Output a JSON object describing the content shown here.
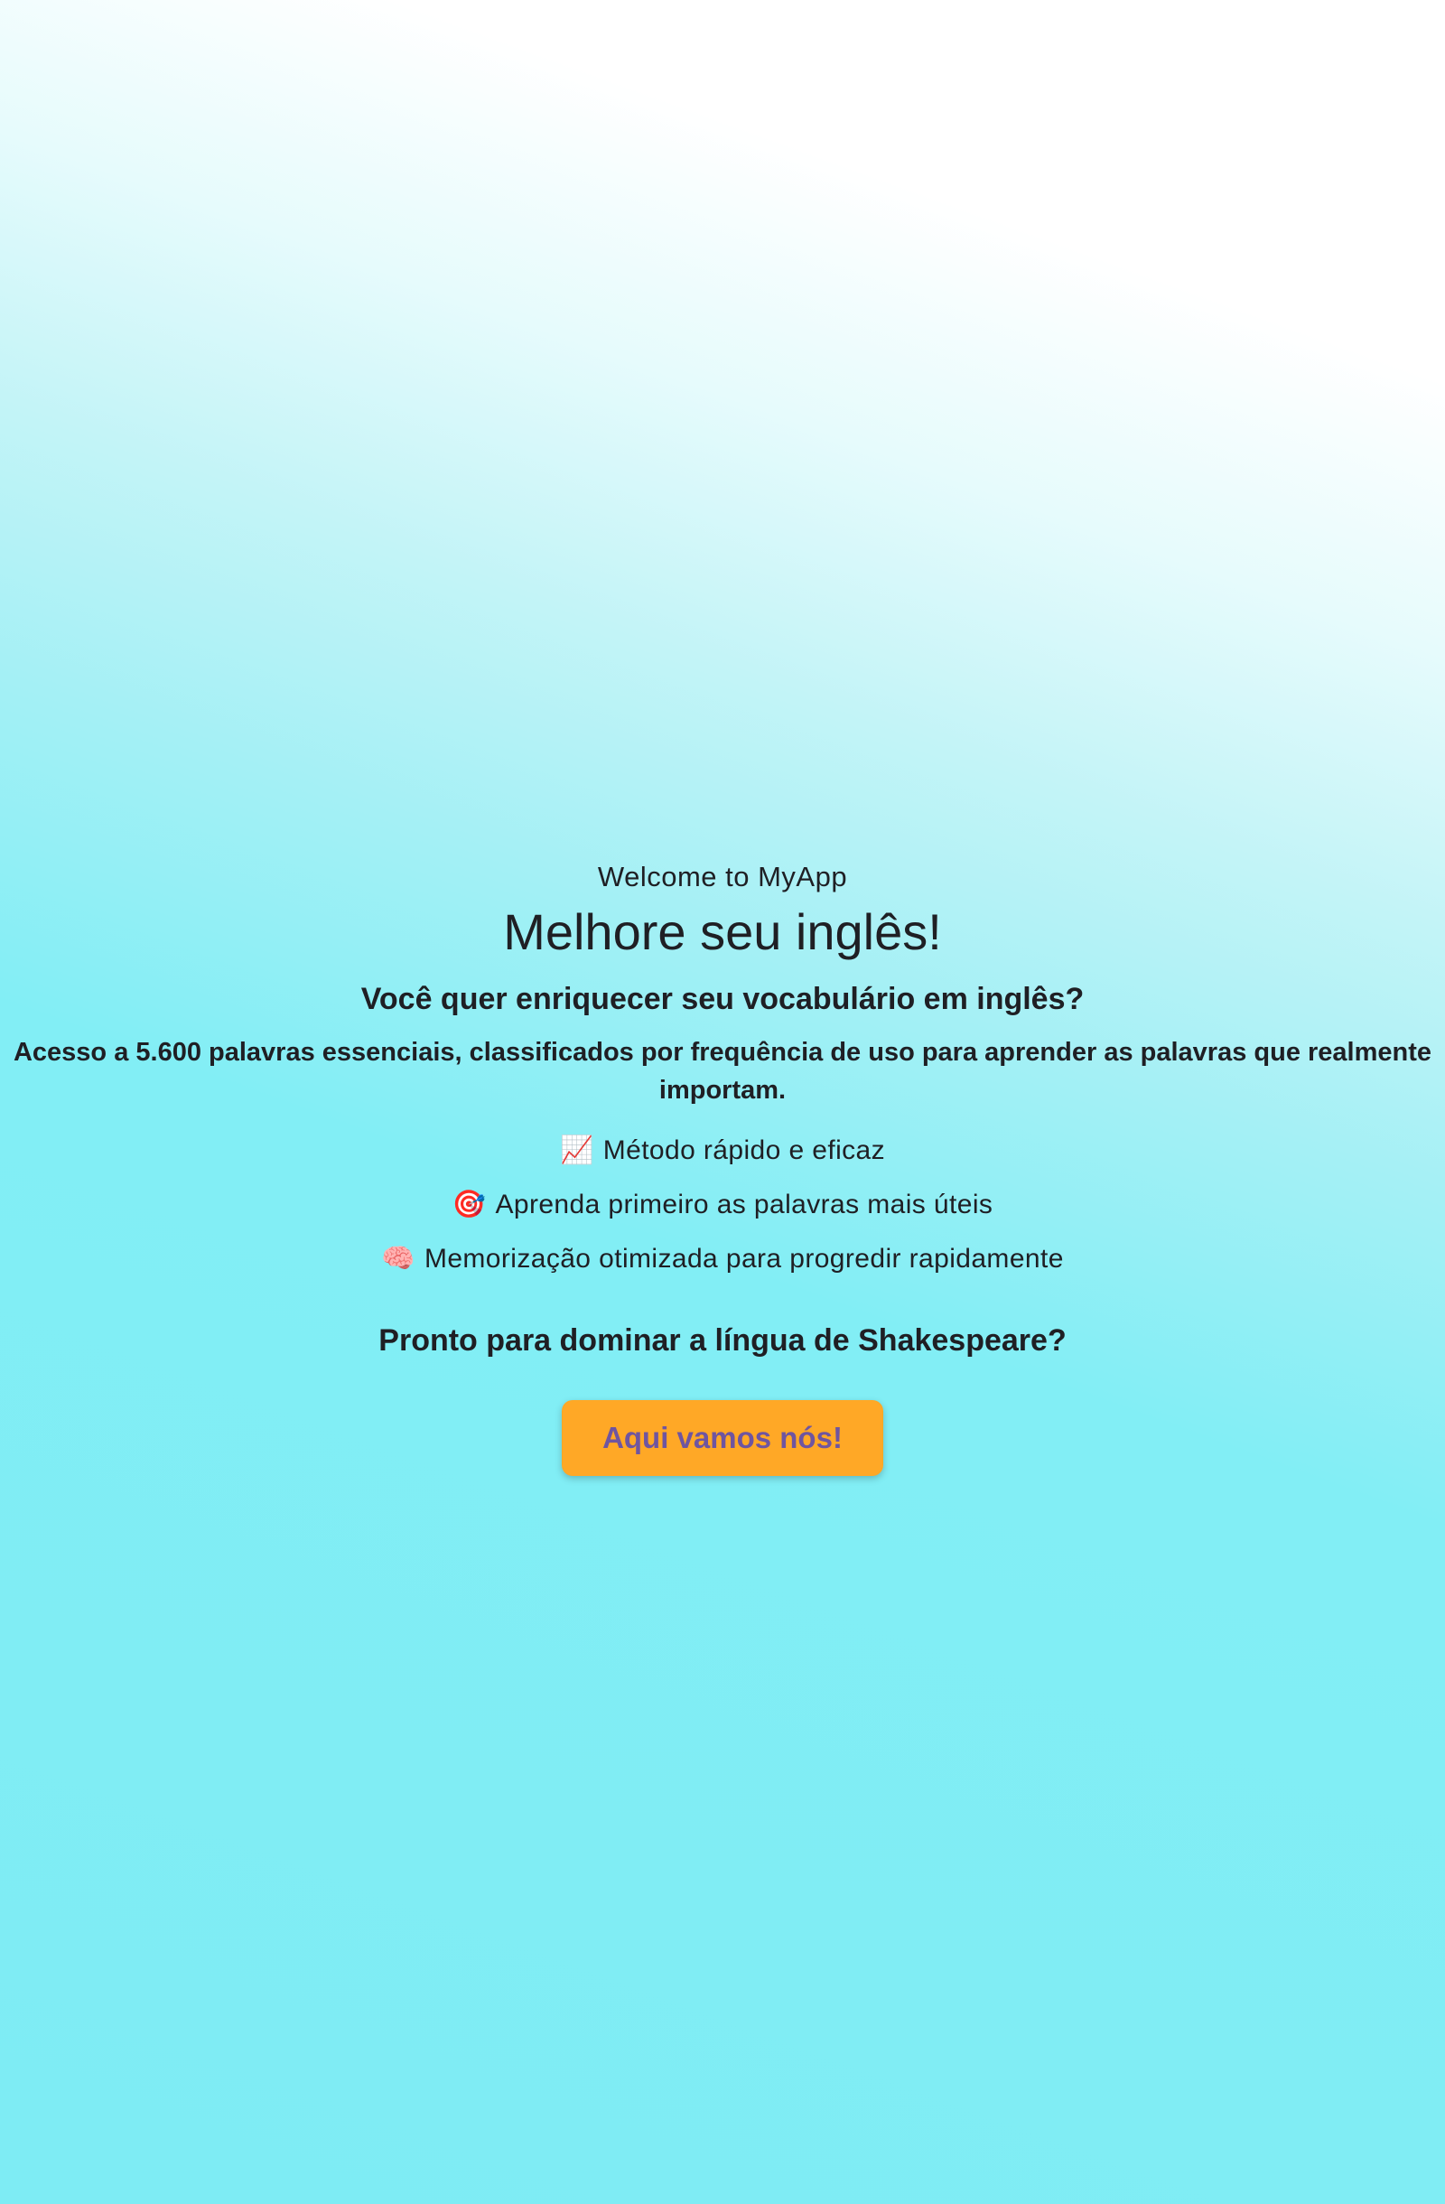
{
  "hero": {
    "welcome": "Welcome to MyApp",
    "headline": "Melhore seu inglês!",
    "question": "Você quer enriquecer seu vocabulário em inglês?",
    "intro_prefix": "Acesso a ",
    "intro_highlight": "5.600 palavras essenciais",
    "intro_suffix": ", classificados por frequência de uso para aprender as palavras que realmente importam."
  },
  "features": [
    {
      "icon": "chart-increasing-icon",
      "emoji": "📈",
      "text": "Método rápido e eficaz"
    },
    {
      "icon": "target-icon",
      "emoji": "🎯",
      "text": "Aprenda primeiro as palavras mais úteis"
    },
    {
      "icon": "brain-icon",
      "emoji": "🧠",
      "text": "Memorização otimizada para progredir rapidamente"
    }
  ],
  "cta": {
    "prompt": "Pronto para dominar a língua de Shakespeare?",
    "button_label": "Aqui vamos nós!"
  },
  "colors": {
    "background_top": "#ffffff",
    "background_main": "#7eecf4",
    "button": "#ffa826",
    "button_text": "#6f55a0",
    "text": "#1f1f24"
  }
}
